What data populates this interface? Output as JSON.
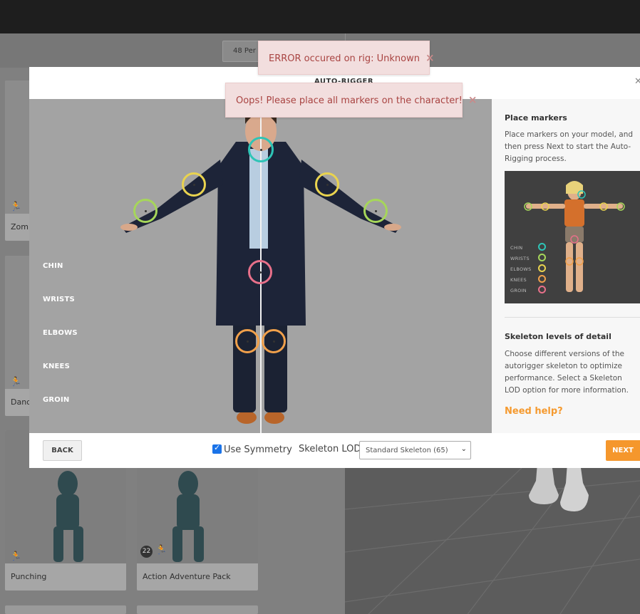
{
  "background": {
    "per_page_label": "48 Per",
    "cards": [
      {
        "label": "Zomb"
      },
      {
        "label": "Danci"
      },
      {
        "label": "Punching"
      },
      {
        "label": "Action Adventure Pack",
        "count": "22"
      }
    ]
  },
  "modal": {
    "title": "AUTO-RIGGER",
    "close_icon": "close-icon",
    "marker_legend": [
      "CHIN",
      "WRISTS",
      "ELBOWS",
      "KNEES",
      "GROIN"
    ],
    "marker_colors": {
      "chin": "#2ec4b6",
      "wrists": "#a6d65a",
      "elbows": "#e9d34f",
      "knees": "#f0a04b",
      "groin": "#e8708a"
    },
    "side": {
      "place_title": "Place markers",
      "place_text": "Place markers on your model, and then press Next to start the Auto-Rigging process.",
      "mini_legend": [
        "CHIN",
        "WRISTS",
        "ELBOWS",
        "KNEES",
        "GROIN"
      ],
      "lod_title": "Skeleton levels of detail",
      "lod_text": "Choose different versions of the autorigger skeleton to optimize performance. Select a Skeleton LOD option for more information.",
      "help_link": "Need help?"
    },
    "footer": {
      "back_label": "BACK",
      "symmetry_label": "Use Symmetry",
      "symmetry_checked": true,
      "lod_label": "Skeleton LOD",
      "lod_value": "Standard Skeleton (65)",
      "next_label": "NEXT"
    }
  },
  "toasts": [
    {
      "message": "ERROR occured on rig: Unknown",
      "close": "×"
    },
    {
      "message": "Oops! Please place all markers on the character!",
      "close": "×"
    }
  ]
}
